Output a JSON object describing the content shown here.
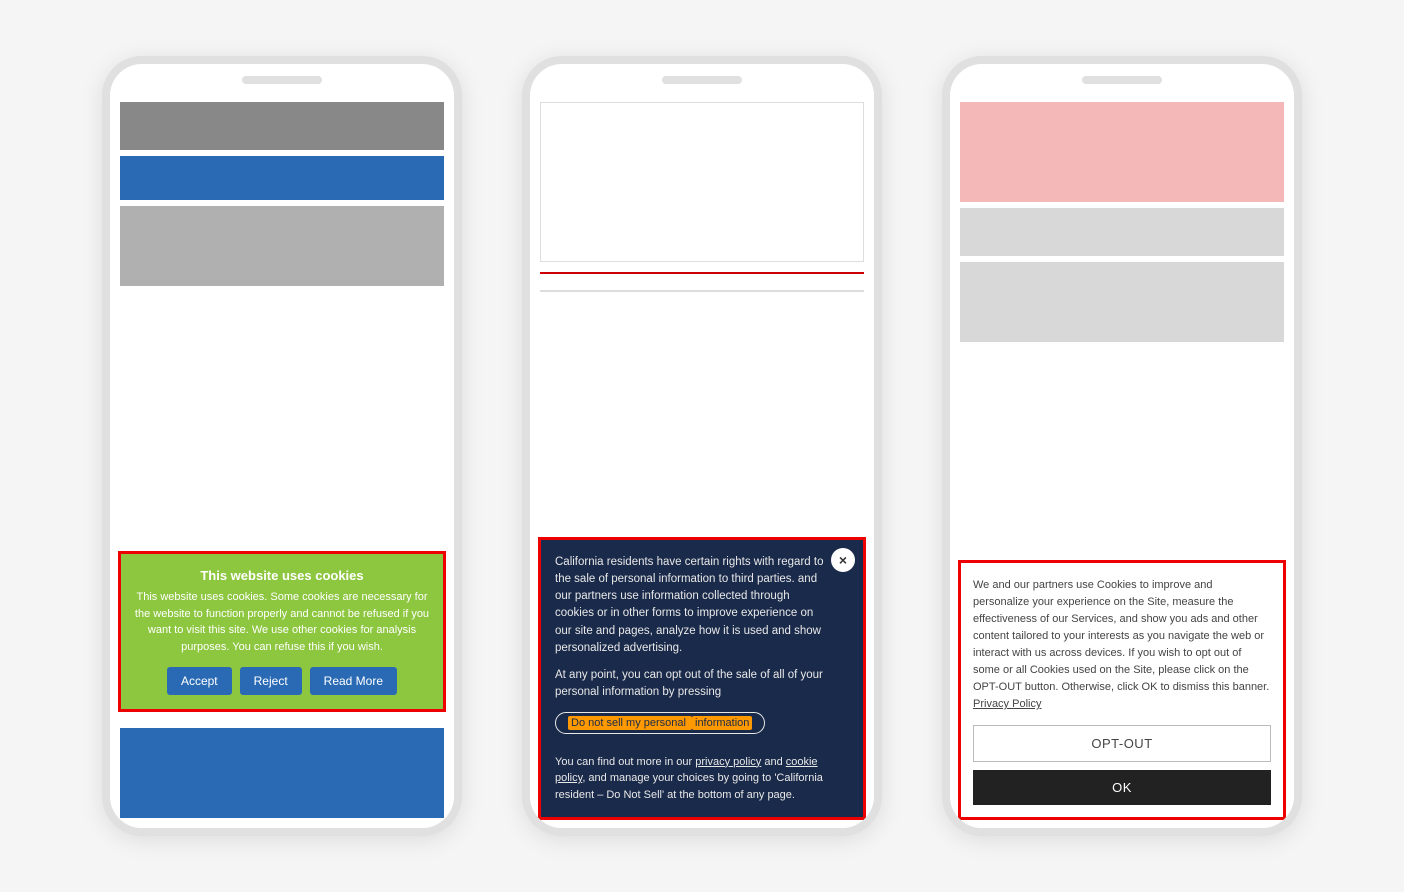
{
  "phone1": {
    "notch": "",
    "cookie": {
      "title": "This website uses cookies",
      "text": "This website uses cookies. Some cookies are necessary for the website to function properly and cannot be refused if you want to visit this site. We use other cookies for analysis purposes. You can refuse this if you wish.",
      "accept_label": "Accept",
      "reject_label": "Reject",
      "read_more_label": "Read More"
    }
  },
  "phone2": {
    "cookie": {
      "close_icon": "×",
      "text1": "California residents have certain rights with regard to the sale of personal information to third parties.         and our partners use information collected through cookies or in other forms to improve experience on our site and pages, analyze how it is used and show personalized advertising.",
      "text2": "At any point, you can opt out of the sale of all of your personal information by pressing",
      "do_not_sell_label": "Do not sell my personal information",
      "do_not_sell_highlight": "information",
      "text3": "You can find out more in our privacy policy and cookie policy, and manage your choices by going to 'California resident – Do Not Sell' at the bottom of any page."
    }
  },
  "phone3": {
    "cookie": {
      "text": "We and our partners use Cookies to improve and personalize your experience on the Site, measure the effectiveness of our Services, and show you ads and other content tailored to your interests as you navigate the web or interact with us across devices. If you wish to opt out of some or all Cookies used on the Site, please click on the OPT-OUT button. Otherwise, click OK to dismiss this banner.",
      "privacy_policy_label": "Privacy Policy",
      "opt_out_label": "OPT-OUT",
      "ok_label": "OK"
    }
  }
}
